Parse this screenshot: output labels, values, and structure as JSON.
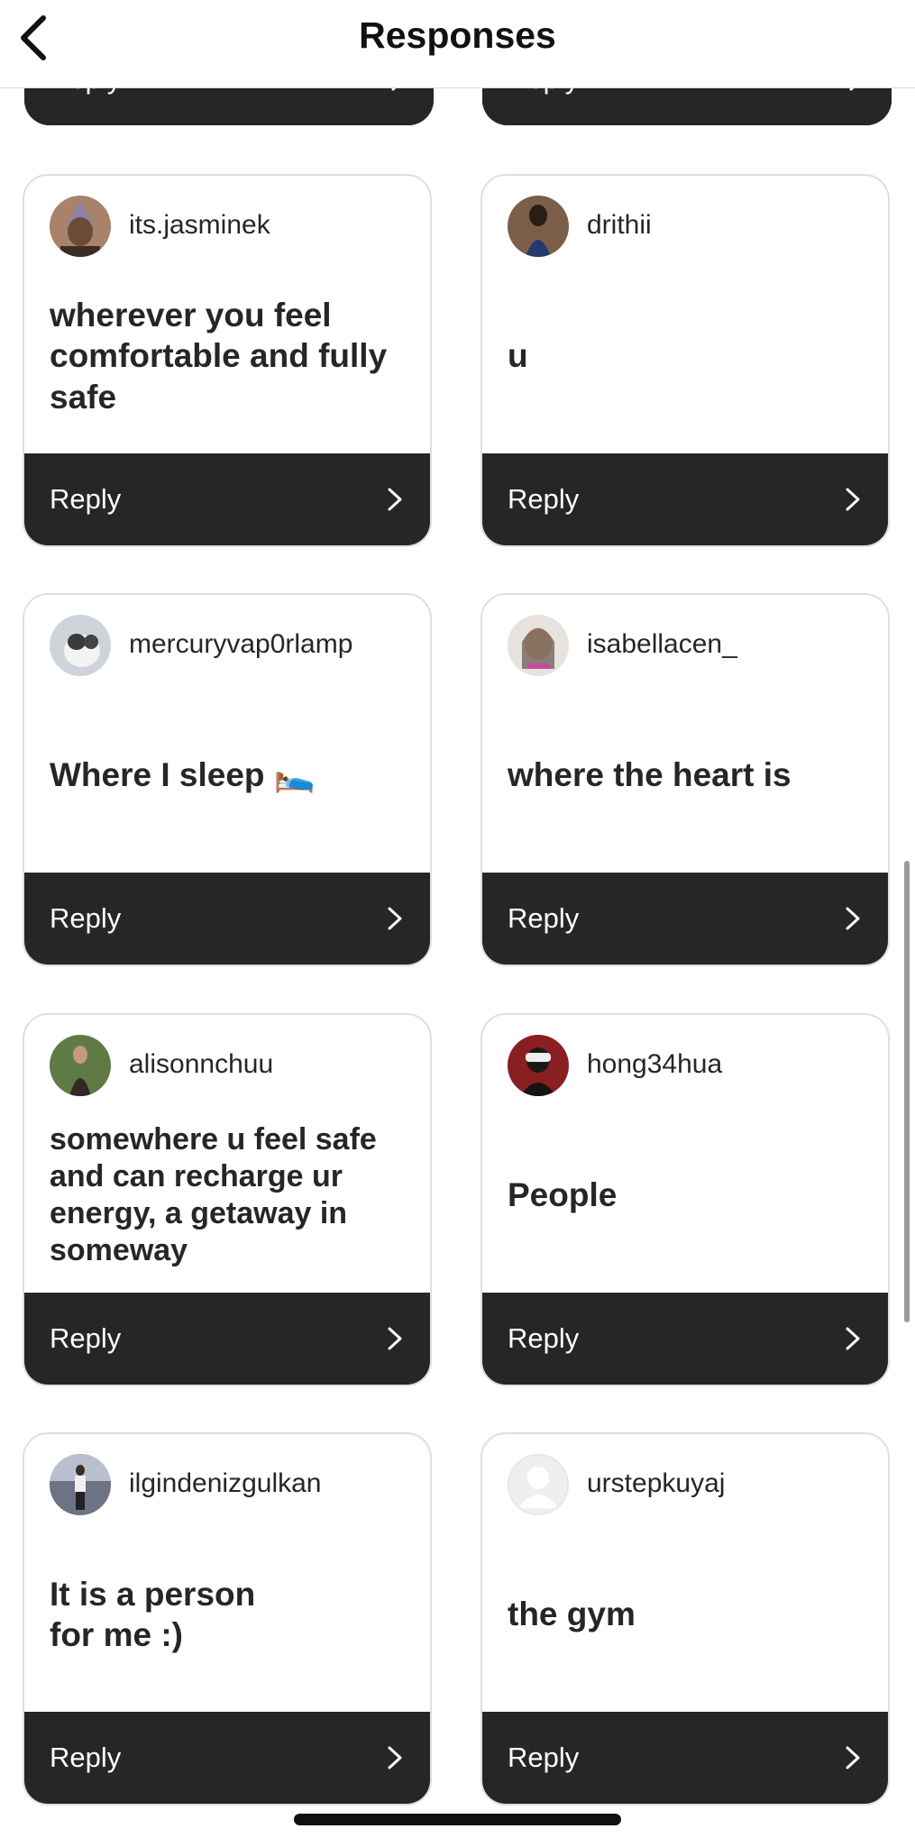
{
  "header": {
    "title": "Responses"
  },
  "reply_label": "Reply",
  "top_partial_cards": [
    {
      "reply_label": "Reply"
    },
    {
      "reply_label": "Reply"
    }
  ],
  "responses": [
    {
      "username": "its.jasminek",
      "text": "wherever you feel comfortable and fully safe",
      "avatar_icon": "avatar-photo"
    },
    {
      "username": "drithii",
      "text": "u",
      "avatar_icon": "avatar-photo"
    },
    {
      "username": "mercuryvap0rlamp",
      "text": "Where I sleep 🛌",
      "avatar_icon": "avatar-photo"
    },
    {
      "username": "isabellacen_",
      "text": "where the heart is",
      "avatar_icon": "avatar-photo"
    },
    {
      "username": "alisonnchuu",
      "text": "somewhere u feel safe and can recharge ur energy, a getaway in someway",
      "avatar_icon": "avatar-photo"
    },
    {
      "username": "hong34hua",
      "text": "People",
      "avatar_icon": "avatar-photo"
    },
    {
      "username": "ilgindenizgulkan",
      "text": "It is a person for me :)",
      "avatar_icon": "avatar-photo"
    },
    {
      "username": "urstepkuyaj",
      "text": "the gym",
      "avatar_icon": "default-avatar"
    }
  ]
}
